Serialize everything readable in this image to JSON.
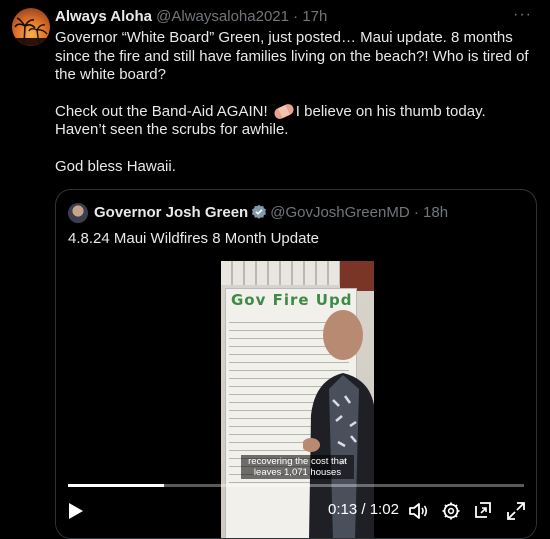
{
  "tweet": {
    "author_name": "Always Aloha",
    "handle": "@Alwaysaloha2021",
    "separator": "·",
    "time": "17h",
    "more_label": "···",
    "paragraph1": "Governor “White Board” Green, just posted… Maui update. 8 months since the fire and still have families living on the beach?! Who is tired of the white board?",
    "paragraph2_before": "Check out the Band-Aid AGAIN!",
    "paragraph2_after": "I believe on his thumb today. Haven’t seen the scrubs for awhile.",
    "paragraph3": "God bless Hawaii."
  },
  "quoted": {
    "author_name": "Governor Josh Green",
    "handle": "@GovJoshGreenMD",
    "separator": "·",
    "time": "18h",
    "text": "4.8.24 Maui Wildfires 8 Month Update",
    "video": {
      "board_title": "Gov Fire Upd",
      "caption_line1": "recovering the cost that",
      "caption_line2": "leaves 1,071 houses",
      "current_time": "0:13",
      "time_separator": "/",
      "duration": "1:02",
      "progress_fraction": 0.21
    }
  },
  "icons": [
    "play-icon",
    "volume-icon",
    "settings-icon",
    "picture-in-picture-icon",
    "fullscreen-icon",
    "verified-badge-icon"
  ]
}
